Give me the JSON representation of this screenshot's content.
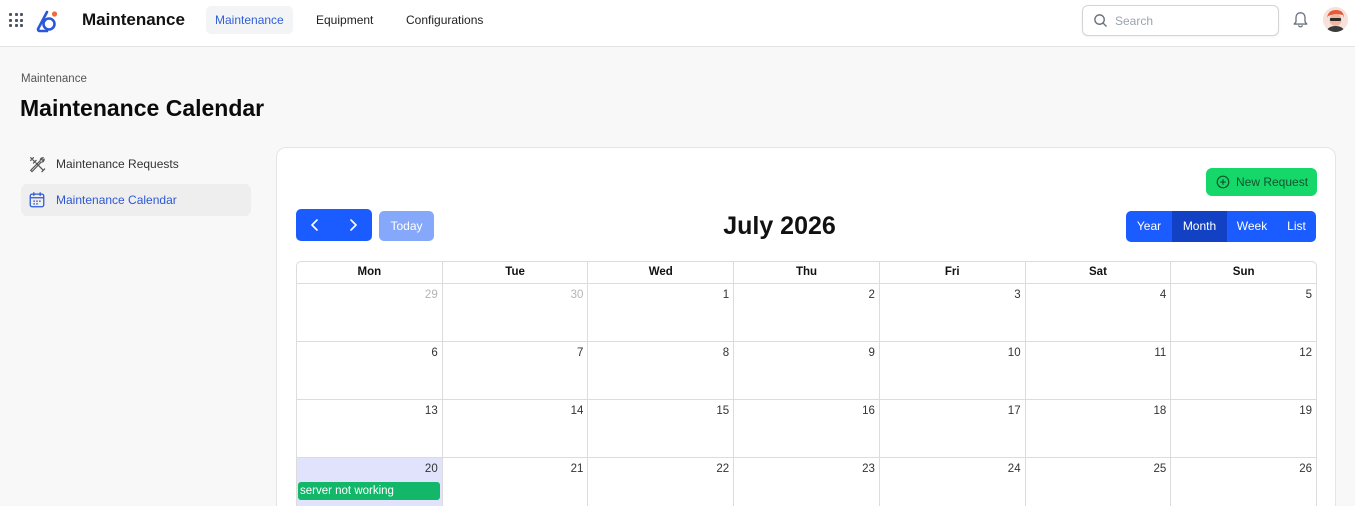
{
  "app": {
    "title": "Maintenance"
  },
  "nav": {
    "tabs": [
      {
        "label": "Maintenance",
        "active": true
      },
      {
        "label": "Equipment",
        "active": false
      },
      {
        "label": "Configurations",
        "active": false
      }
    ]
  },
  "search": {
    "placeholder": "Search",
    "value": ""
  },
  "breadcrumb": "Maintenance",
  "page_title": "Maintenance Calendar",
  "sidebar": {
    "items": [
      {
        "label": "Maintenance Requests",
        "icon": "tools-icon",
        "active": false
      },
      {
        "label": "Maintenance Calendar",
        "icon": "calendar-icon",
        "active": true
      }
    ]
  },
  "toolbar": {
    "new_request_label": "New Request",
    "today_label": "Today"
  },
  "calendar": {
    "title": "July 2026",
    "views": [
      {
        "label": "Year",
        "active": false
      },
      {
        "label": "Month",
        "active": true
      },
      {
        "label": "Week",
        "active": false
      },
      {
        "label": "List",
        "active": false
      }
    ],
    "weekdays": [
      "Mon",
      "Tue",
      "Wed",
      "Thu",
      "Fri",
      "Sat",
      "Sun"
    ],
    "weeks": [
      [
        {
          "day": "29",
          "other": true
        },
        {
          "day": "30",
          "other": true
        },
        {
          "day": "1"
        },
        {
          "day": "2"
        },
        {
          "day": "3"
        },
        {
          "day": "4"
        },
        {
          "day": "5"
        }
      ],
      [
        {
          "day": "6"
        },
        {
          "day": "7"
        },
        {
          "day": "8"
        },
        {
          "day": "9"
        },
        {
          "day": "10"
        },
        {
          "day": "11"
        },
        {
          "day": "12"
        }
      ],
      [
        {
          "day": "13"
        },
        {
          "day": "14"
        },
        {
          "day": "15"
        },
        {
          "day": "16"
        },
        {
          "day": "17"
        },
        {
          "day": "18"
        },
        {
          "day": "19"
        }
      ],
      [
        {
          "day": "20",
          "today": true,
          "event": "server not working"
        },
        {
          "day": "21"
        },
        {
          "day": "22"
        },
        {
          "day": "23"
        },
        {
          "day": "24"
        },
        {
          "day": "25"
        },
        {
          "day": "26"
        }
      ]
    ]
  },
  "colors": {
    "accent": "#1a5cff",
    "accent_dark": "#1241c4",
    "success": "#16d86a",
    "event": "#12b76a",
    "today_bg": "#e0e3fb",
    "active_link": "#2b58d6"
  }
}
